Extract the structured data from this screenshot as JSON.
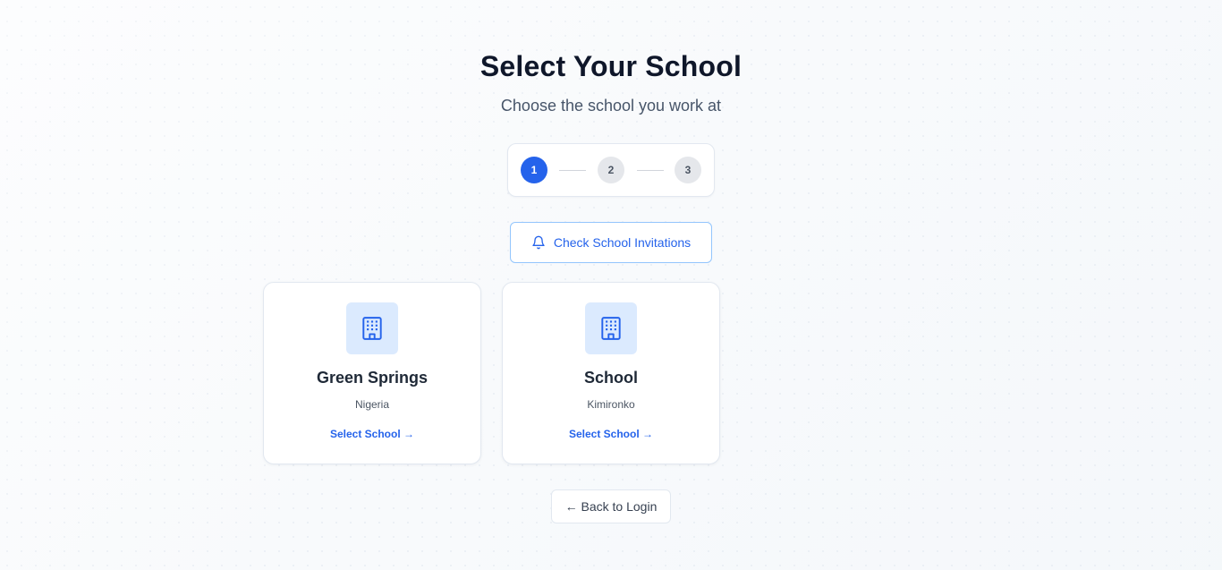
{
  "header": {
    "title": "Select Your School",
    "subtitle": "Choose the school you work at"
  },
  "stepper": {
    "current_step": 1,
    "steps": [
      "1",
      "2",
      "3"
    ]
  },
  "invitations": {
    "label": "Check School Invitations",
    "icon": "bell-icon"
  },
  "schools": [
    {
      "name": "Green Springs",
      "location": "Nigeria",
      "action": "Select School →",
      "icon": "building-icon"
    },
    {
      "name": "School",
      "location": "Kimironko",
      "action": "Select School →",
      "icon": "building-icon"
    }
  ],
  "footer": {
    "back_label": "← Back to Login"
  },
  "colors": {
    "accent": "#2563eb",
    "icon_bg": "#dbeafe",
    "text_dark": "#0f172a"
  }
}
